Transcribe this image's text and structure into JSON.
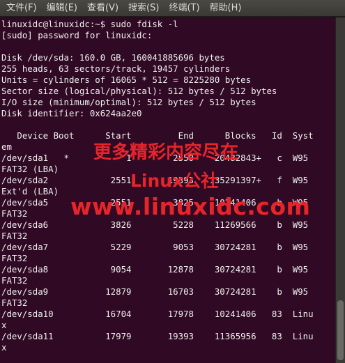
{
  "menubar": {
    "items": [
      "文件(F)",
      "编辑(E)",
      "查看(V)",
      "搜索(S)",
      "终端(T)",
      "帮助(H)"
    ]
  },
  "terminal": {
    "lines": [
      "linuxidc@linuxidc:~$ sudo fdisk -l",
      "[sudo] password for linuxidc:",
      "",
      "Disk /dev/sda: 160.0 GB, 160041885696 bytes",
      "255 heads, 63 sectors/track, 19457 cylinders",
      "Units = cylinders of 16065 * 512 = 8225280 bytes",
      "Sector size (logical/physical): 512 bytes / 512 bytes",
      "I/O size (minimum/optimal): 512 bytes / 512 bytes",
      "Disk identifier: 0x624aa2e0",
      "",
      "   Device Boot      Start         End      Blocks   Id  Syst",
      "em",
      "/dev/sda1   *           1        2550    20482843+   c  W95",
      "FAT32 (LBA)",
      "/dev/sda2            2551       19393   135291397+   f  W95",
      "Ext'd (LBA)",
      "/dev/sda5            2551        3825    10241406    b  W95",
      "FAT32",
      "/dev/sda6            3826        5228    11269566    b  W95",
      "FAT32",
      "/dev/sda7            5229        9053    30724281    b  W95",
      "FAT32",
      "/dev/sda8            9054       12878    30724281    b  W95",
      "FAT32",
      "/dev/sda9           12879       16703    30724281    b  W95",
      "FAT32",
      "/dev/sda10          16704       17978    10241406   83  Linu",
      "x",
      "/dev/sda11          17979       19393    11365956   83  Linu",
      "x"
    ]
  },
  "watermark": {
    "line1": "更多精彩内容尽在",
    "line2": "Linux公社",
    "line3": "www.linuxidc.com"
  },
  "colors": {
    "terminal_bg": "#300a24",
    "terminal_fg": "#f0f0ee",
    "watermark": "#e8242b"
  }
}
